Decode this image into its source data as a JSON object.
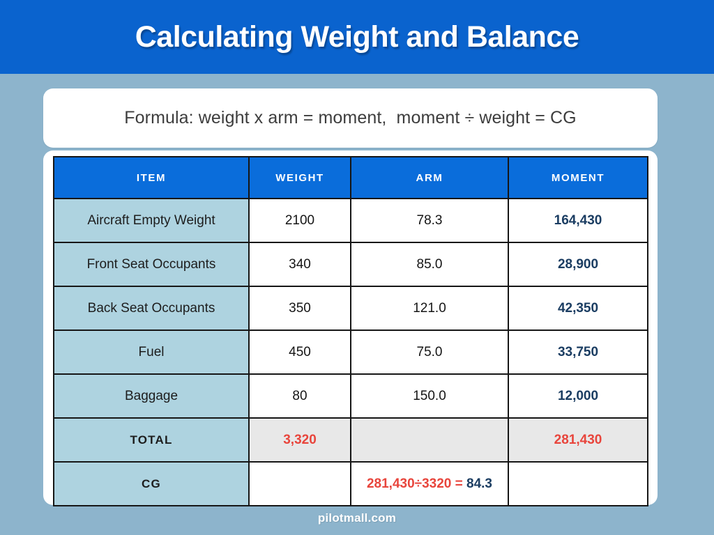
{
  "header": {
    "title": "Calculating Weight and Balance",
    "band_color": "#0a63ce"
  },
  "formula": {
    "text": "Formula: weight x arm = moment,  moment ÷ weight = CG"
  },
  "table": {
    "columns": [
      "ITEM",
      "WEIGHT",
      "ARM",
      "MOMENT"
    ],
    "rows": [
      {
        "item": "Aircraft Empty Weight",
        "weight": "2100",
        "arm": "78.3",
        "moment": "164,430"
      },
      {
        "item": "Front Seat Occupants",
        "weight": "340",
        "arm": "85.0",
        "moment": "28,900"
      },
      {
        "item": "Back Seat Occupants",
        "weight": "350",
        "arm": "121.0",
        "moment": "42,350"
      },
      {
        "item": "Fuel",
        "weight": "450",
        "arm": "75.0",
        "moment": "33,750"
      },
      {
        "item": "Baggage",
        "weight": "80",
        "arm": "150.0",
        "moment": "12,000"
      }
    ],
    "total_row": {
      "item": "TOTAL",
      "weight": "3,320",
      "arm": "",
      "moment": "281,430"
    },
    "cg_row": {
      "item": "CG",
      "weight": "",
      "calc_expression": "281,430÷3320 = ",
      "calc_result": "84.3",
      "moment": ""
    },
    "colors": {
      "header_blue": "#0a6ddb",
      "item_cell": "#aed3e0",
      "total_gray": "#e8e8e8",
      "moment_navy": "#1b3d62",
      "accent_red": "#e8453c",
      "border": "#161616"
    }
  },
  "footer": {
    "watermark": "pilotmall.com"
  },
  "background": {
    "page_color": "#8db4cc",
    "card_color": "#ffffff"
  }
}
